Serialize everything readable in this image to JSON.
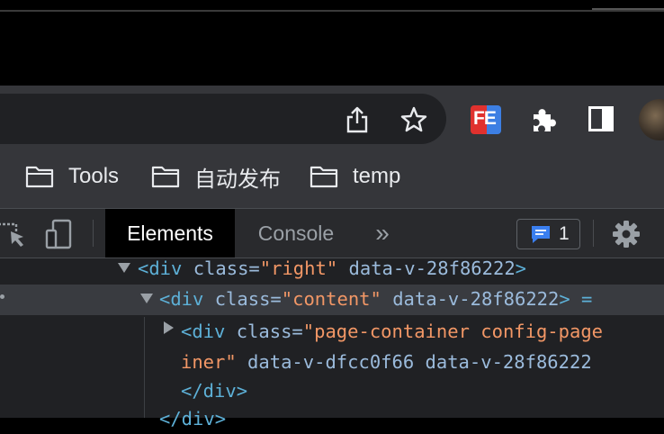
{
  "bookmarks": [
    {
      "label": "Tools"
    },
    {
      "label": "自动发布"
    },
    {
      "label": "temp"
    }
  ],
  "extensions": {
    "fe_label": "FE"
  },
  "devtools": {
    "tabs": [
      "Elements",
      "Console"
    ],
    "more_tabs": "»",
    "issues_count": "1"
  },
  "dom": {
    "line1": {
      "open": "<div ",
      "attr1": "class=",
      "val1": "\"right\"",
      "attr2": " data-v-28f86222",
      "close": ">"
    },
    "line2": {
      "open": "<div ",
      "attr1": "class=",
      "val1": "\"content\"",
      "attr2": " data-v-28f86222",
      "close": "> ="
    },
    "line3": {
      "open": "<div ",
      "attr1": "class=",
      "val1": "\"page-container config-page"
    },
    "line4": {
      "val": "iner\"",
      "attr": " data-v-dfcc0f66 data-v-28f86222"
    },
    "line5": {
      "text": "</div>"
    },
    "line6": {
      "text": "</div>"
    }
  },
  "colors": {
    "toolbar": "#35363a",
    "omnibox": "#202124",
    "devtools_bg": "#202124",
    "tag": "#5db0d7",
    "attr_value": "#f29766"
  }
}
